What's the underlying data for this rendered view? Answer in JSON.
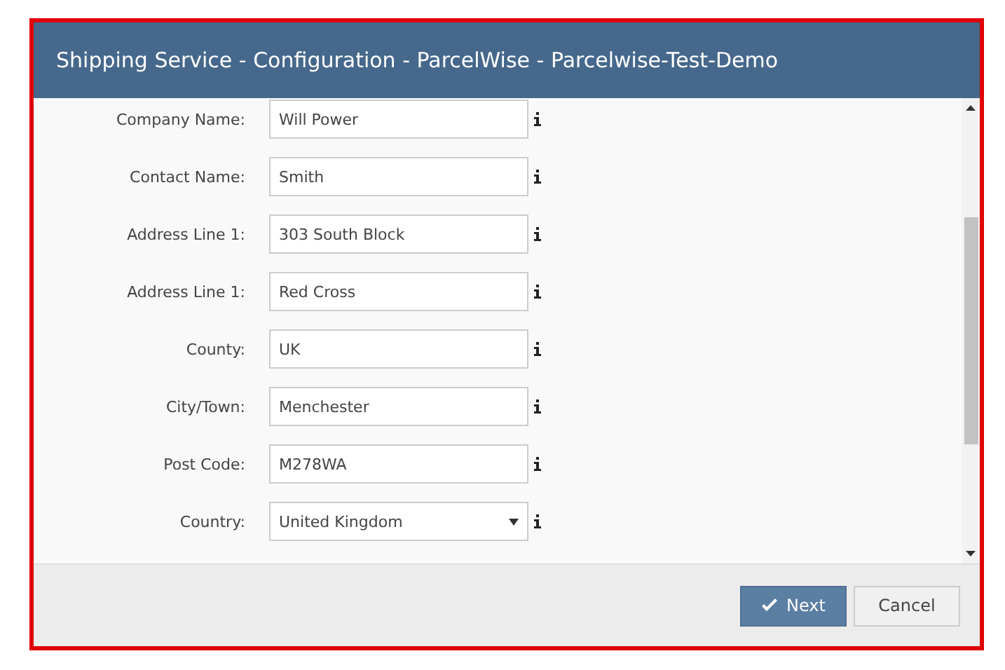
{
  "window": {
    "title": "Shipping Service - Configuration - ParcelWise - Parcelwise-Test-Demo"
  },
  "fields": [
    {
      "kind": "text",
      "label": "Company Name:",
      "value": "Will Power"
    },
    {
      "kind": "text",
      "label": "Contact Name:",
      "value": "Smith"
    },
    {
      "kind": "text",
      "label": "Address Line 1:",
      "value": "303 South Block"
    },
    {
      "kind": "text",
      "label": "Address Line 1:",
      "value": "Red Cross"
    },
    {
      "kind": "text",
      "label": "County:",
      "value": "UK"
    },
    {
      "kind": "text",
      "label": "City/Town:",
      "value": "Menchester"
    },
    {
      "kind": "text",
      "label": "Post Code:",
      "value": "M278WA"
    },
    {
      "kind": "select",
      "label": "Country:",
      "value": "United Kingdom"
    }
  ],
  "buttons": [
    {
      "kind": "primary",
      "label": "Next"
    },
    {
      "kind": "secondary",
      "label": "Cancel"
    }
  ]
}
